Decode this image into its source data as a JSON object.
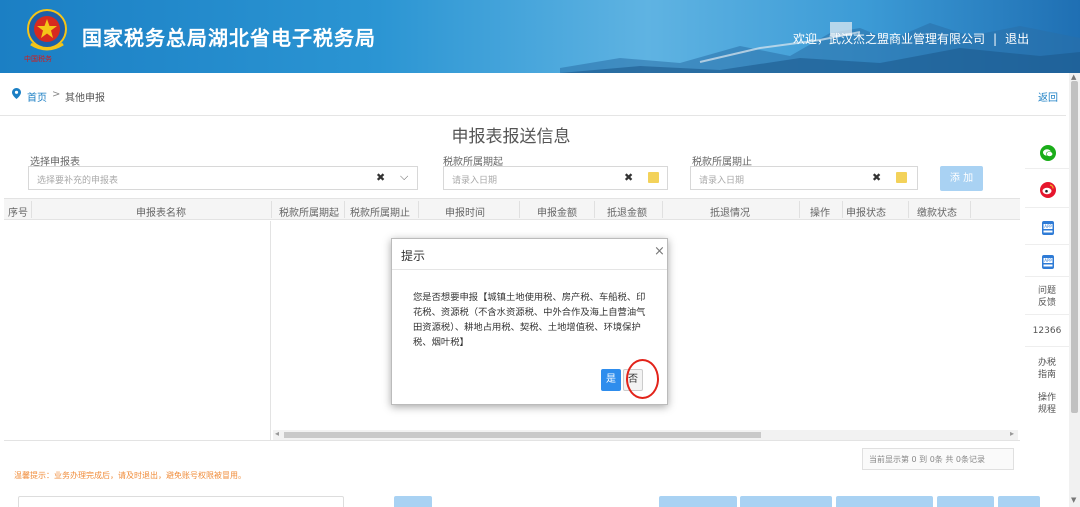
{
  "header": {
    "title": "国家税务总局湖北省电子税务局",
    "logo_text": "中国税务",
    "welcome": "欢迎，",
    "company": "武汉杰之盟商业管理有限公司",
    "separator": "|",
    "logout": "退出"
  },
  "breadcrumb": {
    "home": "首页",
    "arrow": ">",
    "current": "其他申报",
    "back": "返回"
  },
  "form": {
    "heading": "申报表报送信息",
    "report_label": "选择申报表",
    "report_placeholder": "选择要补充的申报表",
    "period_start_label": "税款所属期起",
    "period_start_placeholder": "请录入日期",
    "period_end_label": "税款所属期止",
    "period_end_placeholder": "请录入日期",
    "add_button": "添 加"
  },
  "table": {
    "columns": [
      "序号",
      "申报表名称",
      "税款所属期起",
      "税款所属期止",
      "申报时间",
      "申报金额",
      "抵退金额",
      "抵退情况",
      "操作",
      "申报状态",
      "缴款状态"
    ],
    "rows": [],
    "pager": "当前显示第  0 到  0条 共  0条记录"
  },
  "tip": "温馨提示：业务办理完成后，请及时退出，避免账号权限被冒用。",
  "sidebar": {
    "items": [
      {
        "label": "问题反馈",
        "icon": "question-icon"
      },
      {
        "label": "12366",
        "icon": "hotline"
      },
      {
        "label": "办税指南",
        "icon": "guide"
      },
      {
        "label": "操作规程",
        "icon": "rules"
      }
    ]
  },
  "dialog": {
    "title": "提示",
    "close": "×",
    "message": "您是否想要申报【城镇土地使用税、房产税、车船税、印花税、资源税（不含水资源税、中外合作及海上自营油气田资源税）、耕地占用税、契税、土地增值税、环境保护税、烟叶税】",
    "yes": "是",
    "no": "否"
  },
  "colors": {
    "brand_blue": "#1b7fc4",
    "button_blue": "#2e8ded",
    "highlight_red": "#e2231a",
    "tip_orange": "#f08c3a"
  }
}
